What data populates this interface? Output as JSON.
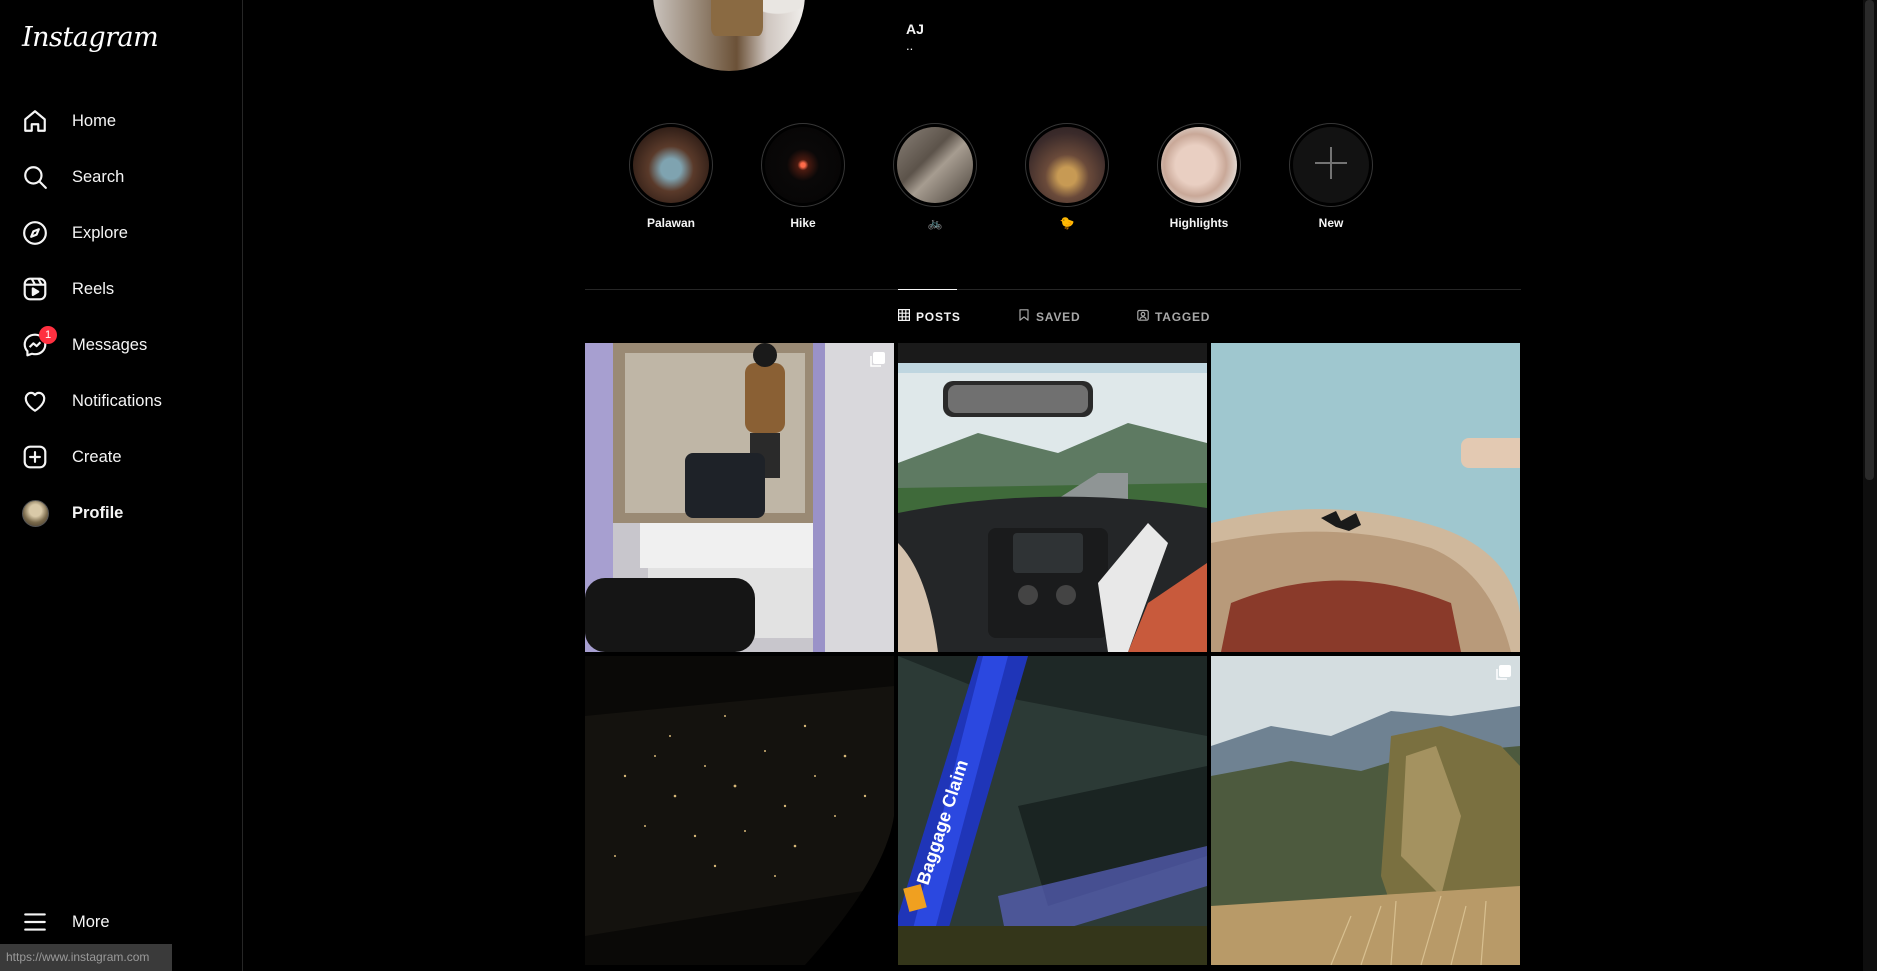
{
  "app": {
    "logo": "Instagram"
  },
  "sidebar": {
    "items": [
      {
        "label": "Home",
        "icon": "home-icon"
      },
      {
        "label": "Search",
        "icon": "search-icon"
      },
      {
        "label": "Explore",
        "icon": "compass-icon"
      },
      {
        "label": "Reels",
        "icon": "reels-icon"
      },
      {
        "label": "Messages",
        "icon": "messenger-icon",
        "badge": "1"
      },
      {
        "label": "Notifications",
        "icon": "heart-icon"
      },
      {
        "label": "Create",
        "icon": "plus-square-icon"
      },
      {
        "label": "Profile",
        "icon": "avatar",
        "active": true
      }
    ],
    "more_label": "More"
  },
  "status_url": "https://www.instagram.com",
  "profile": {
    "name": "AJ",
    "bio": ".."
  },
  "highlights": [
    {
      "label": "Palawan"
    },
    {
      "label": "Hike"
    },
    {
      "label": "🚲"
    },
    {
      "label": "🐤"
    },
    {
      "label": "Highlights"
    },
    {
      "label": "New"
    }
  ],
  "tabs": [
    {
      "label": "POSTS",
      "icon": "grid-icon",
      "active": true
    },
    {
      "label": "SAVED",
      "icon": "bookmark-icon"
    },
    {
      "label": "TAGGED",
      "icon": "tag-icon"
    }
  ],
  "posts": [
    {
      "subject": "mirror-selfie",
      "multi": true
    },
    {
      "subject": "car-dashboard-road",
      "multi": false
    },
    {
      "subject": "cap-against-sky",
      "multi": false
    },
    {
      "subject": "city-lights-night",
      "multi": false
    },
    {
      "subject": "baggage-claim-sign",
      "multi": false,
      "sign_text": "Baggage Claim"
    },
    {
      "subject": "mountain-cliff",
      "multi": true
    }
  ],
  "colors": {
    "background": "#000000",
    "text": "#f5f5f5",
    "muted": "#a8a8a8",
    "badge": "#ff3040",
    "divider": "#262626"
  }
}
